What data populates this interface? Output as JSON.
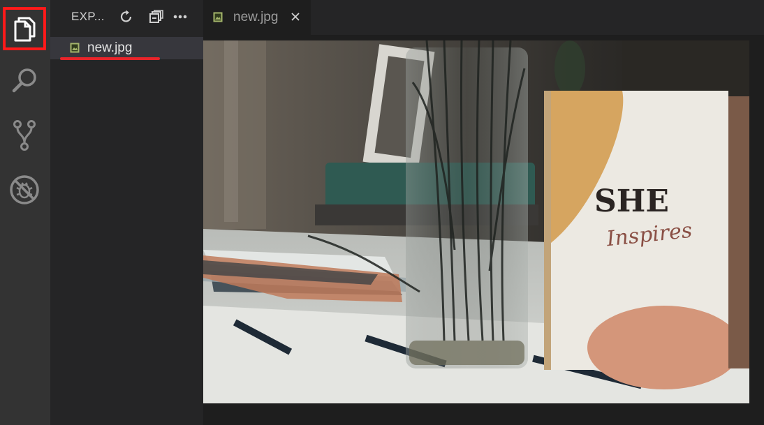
{
  "activity_bar": {
    "items": [
      {
        "name": "explorer",
        "icon": "files-icon",
        "highlighted": true
      },
      {
        "name": "search",
        "icon": "search-icon"
      },
      {
        "name": "source-control",
        "icon": "source-control-icon"
      },
      {
        "name": "debug",
        "icon": "no-bug-icon"
      }
    ],
    "highlight_color": "#ff1a1a"
  },
  "sidebar": {
    "title": "EXP...",
    "actions": [
      "refresh-icon",
      "collapse-all-icon",
      "more-icon"
    ],
    "files": [
      {
        "label": "new.jpg",
        "icon": "image-file-icon",
        "selected": true,
        "underlined": true
      }
    ],
    "underline_color": "#e8242a"
  },
  "editor": {
    "tabs": [
      {
        "label": "new.jpg",
        "icon": "image-file-icon",
        "active": true,
        "close_glyph": "✕"
      }
    ],
    "image": {
      "description_tag": "photo",
      "book_title": "SHE",
      "book_subtitle": "Inspires"
    }
  },
  "colors": {
    "activity_bar_bg": "#333333",
    "sidebar_bg": "#252526",
    "editor_bg": "#1e1e1e",
    "selected_row_bg": "#37373d"
  }
}
